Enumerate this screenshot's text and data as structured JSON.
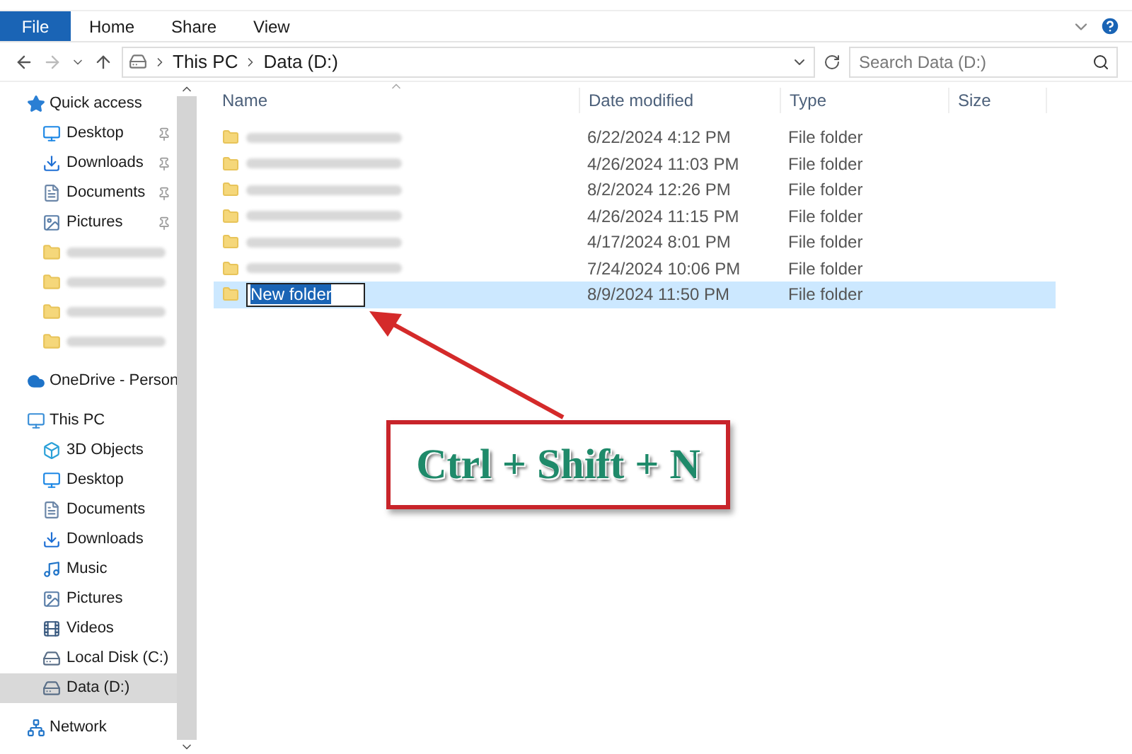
{
  "ribbon": {
    "file_tab": "File",
    "tabs": [
      "Home",
      "Share",
      "View"
    ]
  },
  "address_bar": {
    "path": [
      "This PC",
      "Data (D:)"
    ]
  },
  "search": {
    "placeholder": "Search Data (D:)"
  },
  "sidebar": {
    "groups": [
      {
        "kind": "quick",
        "label": "Quick access",
        "children": [
          {
            "kind": "desktop",
            "label": "Desktop",
            "pinned": true
          },
          {
            "kind": "download",
            "label": "Downloads",
            "pinned": true
          },
          {
            "kind": "document",
            "label": "Documents",
            "pinned": true
          },
          {
            "kind": "picture",
            "label": "Pictures",
            "pinned": true
          },
          {
            "kind": "blurred"
          },
          {
            "kind": "blurred"
          },
          {
            "kind": "blurred"
          },
          {
            "kind": "blurred"
          }
        ]
      },
      {
        "kind": "cloud",
        "label": "OneDrive - Person"
      },
      {
        "kind": "pc",
        "label": "This PC",
        "children": [
          {
            "kind": "cube",
            "label": "3D Objects",
            "selected": false
          },
          {
            "kind": "desktop",
            "label": "Desktop",
            "selected": false
          },
          {
            "kind": "document",
            "label": "Documents",
            "selected": false
          },
          {
            "kind": "download",
            "label": "Downloads",
            "selected": false
          },
          {
            "kind": "music",
            "label": "Music",
            "selected": false
          },
          {
            "kind": "picture",
            "label": "Pictures",
            "selected": false
          },
          {
            "kind": "video",
            "label": "Videos",
            "selected": false
          },
          {
            "kind": "disk",
            "label": "Local Disk (C:)",
            "selected": false
          },
          {
            "kind": "disk",
            "label": "Data (D:)",
            "selected": true
          }
        ]
      },
      {
        "kind": "network",
        "label": "Network"
      }
    ]
  },
  "table": {
    "columns": [
      "Name",
      "Date modified",
      "Type",
      "Size"
    ],
    "rows": [
      {
        "kind": "blurred",
        "date": "6/22/2024 4:12 PM",
        "type": "File folder",
        "selected": false
      },
      {
        "kind": "blurred",
        "date": "4/26/2024 11:03 PM",
        "type": "File folder",
        "selected": false
      },
      {
        "kind": "blurred",
        "date": "8/2/2024 12:26 PM",
        "type": "File folder",
        "selected": false
      },
      {
        "kind": "blurred",
        "date": "4/26/2024 11:15 PM",
        "type": "File folder",
        "selected": false
      },
      {
        "kind": "blurred",
        "date": "4/17/2024 8:01 PM",
        "type": "File folder",
        "selected": false
      },
      {
        "kind": "blurred",
        "date": "7/24/2024 10:06 PM",
        "type": "File folder",
        "selected": false
      },
      {
        "kind": "renaming",
        "name": "New folder",
        "date": "8/9/2024 11:50 PM",
        "type": "File folder",
        "selected": true
      }
    ]
  },
  "annotation": {
    "shortcut": "Ctrl + Shift + N"
  }
}
